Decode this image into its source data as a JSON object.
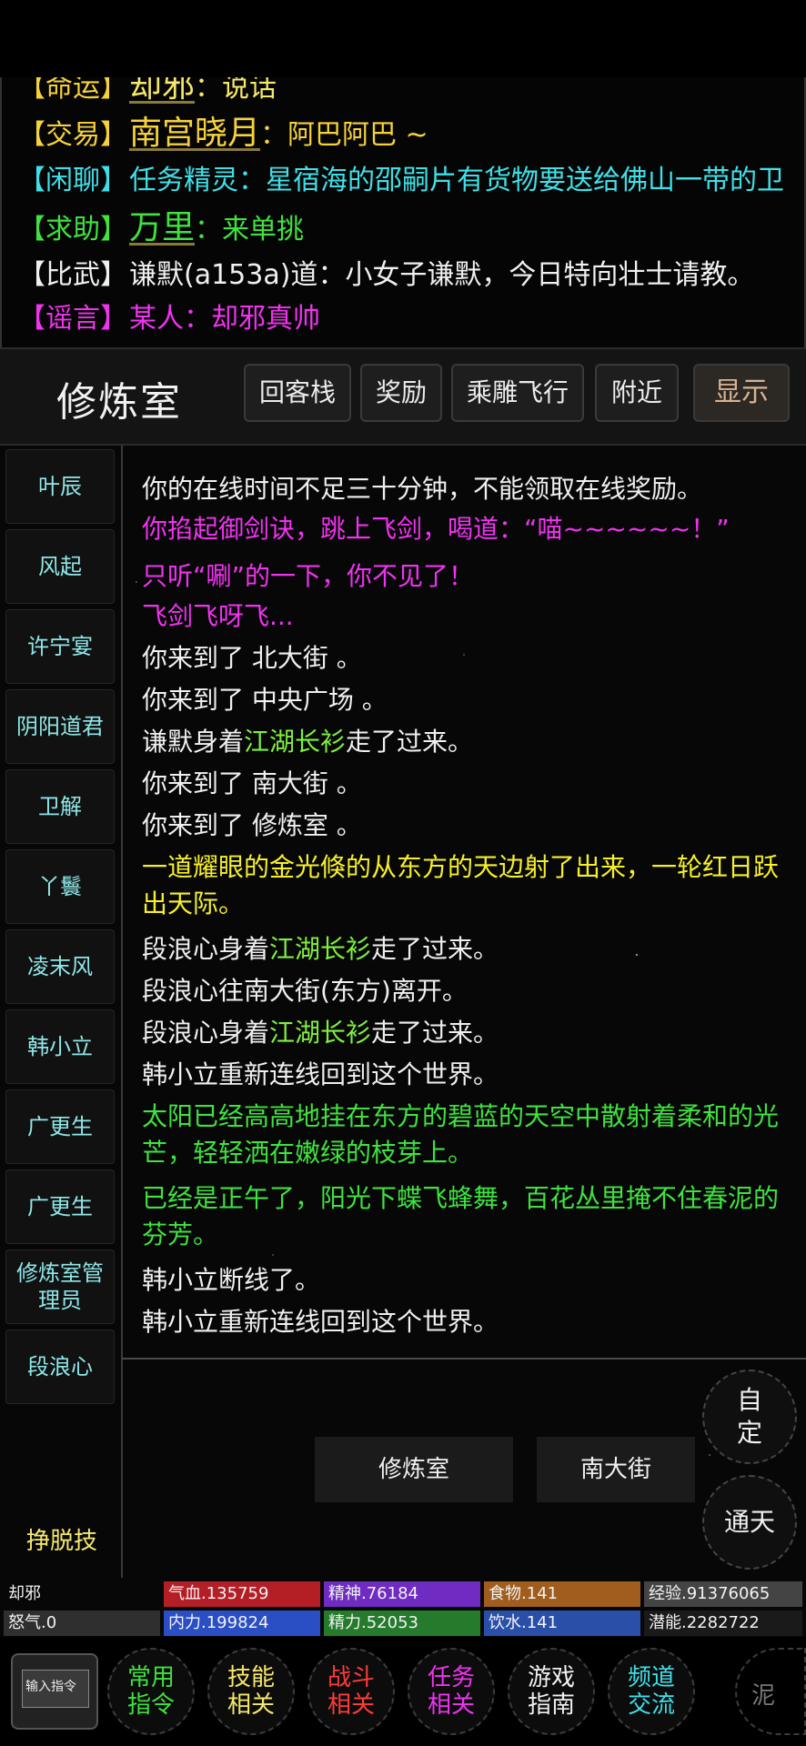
{
  "chat": [
    {
      "tag": "【命运】",
      "speaker": "却邪",
      "sep": "：",
      "text": "说话",
      "tag_color": "#f6d23a",
      "speaker_color": "#f6e96a",
      "text_color": "#f6e96a"
    },
    {
      "tag": "【交易】",
      "speaker": "南宫晓月",
      "sep": "：",
      "text": "阿巴阿巴 ~",
      "tag_color": "#f6d23a",
      "speaker_color": "#f6d23a",
      "text_color": "#f6d23a"
    },
    {
      "tag": "【闲聊】",
      "speaker": "任务精灵",
      "sep": "：",
      "text": "星宿海的邵嗣片有货物要送给佛山一带的卫",
      "tag_color": "#3ee0e8",
      "speaker_color": "#3ee0e8",
      "text_color": "#3ee0e8"
    },
    {
      "tag": "【求助】",
      "speaker": "万里",
      "sep": "：",
      "text": "来单挑",
      "tag_color": "#3fe23f",
      "speaker_color": "#3fe23f",
      "text_color": "#3fe23f"
    },
    {
      "tag": "【比武】",
      "speaker": "谦默(a153a)道",
      "sep": "：",
      "text": "小女子谦默，今日特向壮士请教。",
      "tag_color": "#f0f0f0",
      "speaker_color": "#f0f0f0",
      "text_color": "#f0f0f0"
    },
    {
      "tag": "【谣言】",
      "speaker": "某人",
      "sep": "：",
      "text": "却邪真帅",
      "tag_color": "#f033f0",
      "speaker_color": "#f033f0",
      "text_color": "#f033f0"
    }
  ],
  "location": {
    "title": "修炼室"
  },
  "header_buttons": [
    "回客栈",
    "奖励",
    "乘雕飞行",
    "附近",
    "显示"
  ],
  "npcs": [
    "叶辰",
    "风起",
    "许宁宴",
    "阴阳道君",
    "卫解",
    "丫鬟",
    "凌末风",
    "韩小立",
    "广更生",
    "广更生",
    "修炼室管理员",
    "段浪心"
  ],
  "log": {
    "l1": "你的在线时间不足三十分钟，不能领取在线奖励。",
    "l2": "你掐起御剑诀，跳上飞剑，喝道：“喵~~~~~~！”",
    "l3": "只听“唰”的一下，你不见了！",
    "l4": "飞剑飞呀飞...",
    "l5": "你来到了 北大街 。",
    "l6": "你来到了 中央广场 。",
    "l7a": "谦默身着",
    "l7b": "江湖长衫",
    "l7c": "走了过来。",
    "l8": "你来到了 南大街 。",
    "l9": "你来到了 修炼室 。",
    "l10": "一道耀眼的金光倏的从东方的天边射了出来，一轮红日跃出天际。",
    "l11a": "段浪心身着",
    "l11b": "江湖长衫",
    "l11c": "走了过来。",
    "l12": "段浪心往南大街(东方)离开。",
    "l13a": "段浪心身着",
    "l13b": "江湖长衫",
    "l13c": "走了过来。",
    "l14": "韩小立重新连线回到这个世界。",
    "l15": "太阳已经高高地挂在东方的碧蓝的天空中散射着柔和的光芒，轻轻洒在嫩绿的枝芽上。",
    "l16": "已经是正午了，阳光下蝶飞蜂舞，百花丛里掩不住春泥的芬芳。",
    "l17": "韩小立断线了。",
    "l18": "韩小立重新连线回到这个世界。"
  },
  "exits": {
    "west": "修炼室",
    "east": "南大街"
  },
  "side_buttons": {
    "custom": "自定",
    "tongtian": "通天",
    "escape": "挣脱技"
  },
  "stats": {
    "name": "却邪",
    "qixue": "气血.135759",
    "jingshen": "精神.76184",
    "shiwu": "食物.141",
    "jingyan": "经验.91376065",
    "nuqi": "怒气.0",
    "neili": "内力.199824",
    "jingli": "精力.52053",
    "yinshui": "饮水.141",
    "qianneng": "潜能.2282722"
  },
  "nav": {
    "input": "输入指令",
    "items": [
      {
        "label": "常用指令",
        "color": "#3fe23f"
      },
      {
        "label": "技能相关",
        "color": "#f6e96a"
      },
      {
        "label": "战斗相关",
        "color": "#ff3b3b"
      },
      {
        "label": "任务相关",
        "color": "#f033f0"
      },
      {
        "label": "游戏指南",
        "color": "#f0f0f0"
      },
      {
        "label": "频道交流",
        "color": "#3ee0e8"
      }
    ],
    "logo": "泥"
  }
}
